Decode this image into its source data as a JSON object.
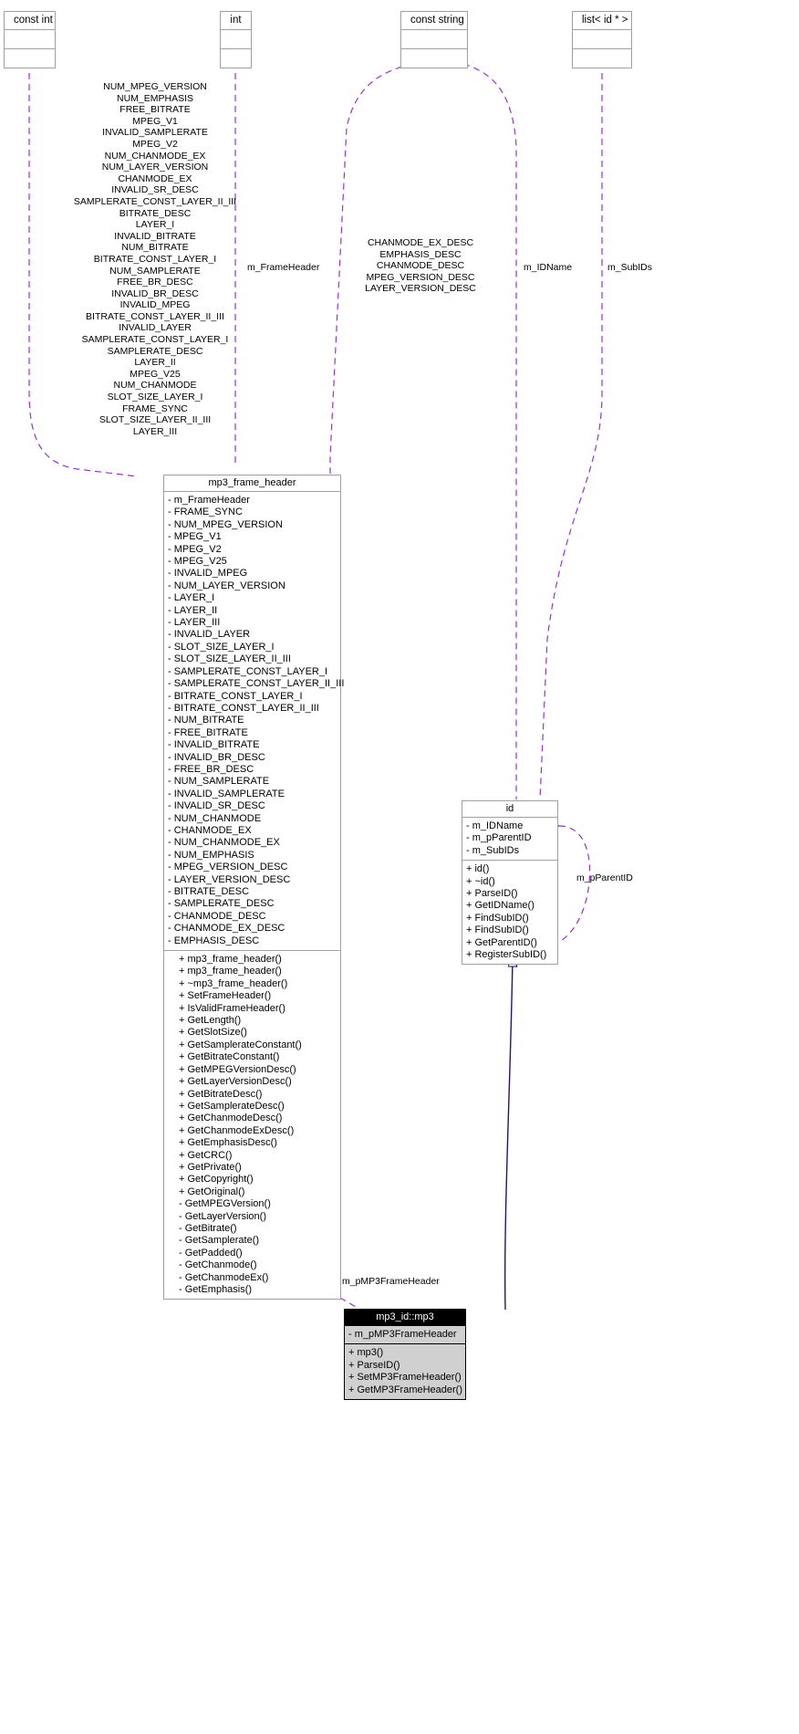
{
  "diagram": {
    "kind": "uml-collaboration-diagram",
    "colors": {
      "usage_edge": "#9a32cd",
      "inheritance_edge": "#191970",
      "box_border": "#a0a0a0",
      "current_header_bg": "#000000",
      "current_header_fg": "#ffffff",
      "current_body_bg": "#d0d0d0"
    }
  },
  "type_boxes": [
    {
      "name": "const int"
    },
    {
      "name": "int"
    },
    {
      "name": "const string"
    },
    {
      "name": "list< id * >"
    }
  ],
  "edge_labels": {
    "const_int_members": [
      "NUM_MPEG_VERSION",
      "NUM_EMPHASIS",
      "FREE_BITRATE",
      "MPEG_V1",
      "INVALID_SAMPLERATE",
      "MPEG_V2",
      "NUM_CHANMODE_EX",
      "NUM_LAYER_VERSION",
      "CHANMODE_EX",
      "INVALID_SR_DESC",
      "SAMPLERATE_CONST_LAYER_II_III",
      "BITRATE_DESC",
      "LAYER_I",
      "INVALID_BITRATE",
      "NUM_BITRATE",
      "BITRATE_CONST_LAYER_I",
      "NUM_SAMPLERATE",
      "FREE_BR_DESC",
      "INVALID_BR_DESC",
      "INVALID_MPEG",
      "BITRATE_CONST_LAYER_II_III",
      "INVALID_LAYER",
      "SAMPLERATE_CONST_LAYER_I",
      "SAMPLERATE_DESC",
      "LAYER_II",
      "MPEG_V25",
      "NUM_CHANMODE",
      "SLOT_SIZE_LAYER_I",
      "FRAME_SYNC",
      "SLOT_SIZE_LAYER_II_III",
      "LAYER_III"
    ],
    "int_member": "m_FrameHeader",
    "const_string_members": [
      "CHANMODE_EX_DESC",
      "EMPHASIS_DESC",
      "CHANMODE_DESC",
      "MPEG_VERSION_DESC",
      "LAYER_VERSION_DESC"
    ],
    "id_name_member": "m_IDName",
    "sub_ids_member": "m_SubIDs",
    "parent_id_member": "m_pParentID",
    "mp3_frame_header_member": "m_pMP3FrameHeader"
  },
  "classes": {
    "mp3_frame_header": {
      "name": "mp3_frame_header",
      "attributes": [
        {
          "vis": "-",
          "label": "m_FrameHeader"
        },
        {
          "vis": "-",
          "label": "FRAME_SYNC"
        },
        {
          "vis": "-",
          "label": "NUM_MPEG_VERSION"
        },
        {
          "vis": "-",
          "label": "MPEG_V1"
        },
        {
          "vis": "-",
          "label": "MPEG_V2"
        },
        {
          "vis": "-",
          "label": "MPEG_V25"
        },
        {
          "vis": "-",
          "label": "INVALID_MPEG"
        },
        {
          "vis": "-",
          "label": "NUM_LAYER_VERSION"
        },
        {
          "vis": "-",
          "label": "LAYER_I"
        },
        {
          "vis": "-",
          "label": "LAYER_II"
        },
        {
          "vis": "-",
          "label": "LAYER_III"
        },
        {
          "vis": "-",
          "label": "INVALID_LAYER"
        },
        {
          "vis": "-",
          "label": "SLOT_SIZE_LAYER_I"
        },
        {
          "vis": "-",
          "label": "SLOT_SIZE_LAYER_II_III"
        },
        {
          "vis": "-",
          "label": "SAMPLERATE_CONST_LAYER_I"
        },
        {
          "vis": "-",
          "label": "SAMPLERATE_CONST_LAYER_II_III"
        },
        {
          "vis": "-",
          "label": "BITRATE_CONST_LAYER_I"
        },
        {
          "vis": "-",
          "label": "BITRATE_CONST_LAYER_II_III"
        },
        {
          "vis": "-",
          "label": "NUM_BITRATE"
        },
        {
          "vis": "-",
          "label": "FREE_BITRATE"
        },
        {
          "vis": "-",
          "label": "INVALID_BITRATE"
        },
        {
          "vis": "-",
          "label": "INVALID_BR_DESC"
        },
        {
          "vis": "-",
          "label": "FREE_BR_DESC"
        },
        {
          "vis": "-",
          "label": "NUM_SAMPLERATE"
        },
        {
          "vis": "-",
          "label": "INVALID_SAMPLERATE"
        },
        {
          "vis": "-",
          "label": "INVALID_SR_DESC"
        },
        {
          "vis": "-",
          "label": "NUM_CHANMODE"
        },
        {
          "vis": "-",
          "label": "CHANMODE_EX"
        },
        {
          "vis": "-",
          "label": "NUM_CHANMODE_EX"
        },
        {
          "vis": "-",
          "label": "NUM_EMPHASIS"
        },
        {
          "vis": "-",
          "label": "MPEG_VERSION_DESC"
        },
        {
          "vis": "-",
          "label": "LAYER_VERSION_DESC"
        },
        {
          "vis": "-",
          "label": "BITRATE_DESC"
        },
        {
          "vis": "-",
          "label": "SAMPLERATE_DESC"
        },
        {
          "vis": "-",
          "label": "CHANMODE_DESC"
        },
        {
          "vis": "-",
          "label": "CHANMODE_EX_DESC"
        },
        {
          "vis": "-",
          "label": "EMPHASIS_DESC"
        }
      ],
      "methods": [
        {
          "vis": "+",
          "label": "mp3_frame_header()"
        },
        {
          "vis": "+",
          "label": "mp3_frame_header()"
        },
        {
          "vis": "+",
          "label": "~mp3_frame_header()"
        },
        {
          "vis": "+",
          "label": "SetFrameHeader()"
        },
        {
          "vis": "+",
          "label": "IsValidFrameHeader()"
        },
        {
          "vis": "+",
          "label": "GetLength()"
        },
        {
          "vis": "+",
          "label": "GetSlotSize()"
        },
        {
          "vis": "+",
          "label": "GetSamplerateConstant()"
        },
        {
          "vis": "+",
          "label": "GetBitrateConstant()"
        },
        {
          "vis": "+",
          "label": "GetMPEGVersionDesc()"
        },
        {
          "vis": "+",
          "label": "GetLayerVersionDesc()"
        },
        {
          "vis": "+",
          "label": "GetBitrateDesc()"
        },
        {
          "vis": "+",
          "label": "GetSamplerateDesc()"
        },
        {
          "vis": "+",
          "label": "GetChanmodeDesc()"
        },
        {
          "vis": "+",
          "label": "GetChanmodeExDesc()"
        },
        {
          "vis": "+",
          "label": "GetEmphasisDesc()"
        },
        {
          "vis": "+",
          "label": "GetCRC()"
        },
        {
          "vis": "+",
          "label": "GetPrivate()"
        },
        {
          "vis": "+",
          "label": "GetCopyright()"
        },
        {
          "vis": "+",
          "label": "GetOriginal()"
        },
        {
          "vis": "-",
          "label": "GetMPEGVersion()"
        },
        {
          "vis": "-",
          "label": "GetLayerVersion()"
        },
        {
          "vis": "-",
          "label": "GetBitrate()"
        },
        {
          "vis": "-",
          "label": "GetSamplerate()"
        },
        {
          "vis": "-",
          "label": "GetPadded()"
        },
        {
          "vis": "-",
          "label": "GetChanmode()"
        },
        {
          "vis": "-",
          "label": "GetChanmodeEx()"
        },
        {
          "vis": "-",
          "label": "GetEmphasis()"
        }
      ]
    },
    "id": {
      "name": "id",
      "attributes": [
        {
          "vis": "-",
          "label": "m_IDName"
        },
        {
          "vis": "-",
          "label": "m_pParentID"
        },
        {
          "vis": "-",
          "label": "m_SubIDs"
        }
      ],
      "methods": [
        {
          "vis": "+",
          "label": "id()"
        },
        {
          "vis": "+",
          "label": "~id()"
        },
        {
          "vis": "+",
          "label": "ParseID()"
        },
        {
          "vis": "+",
          "label": "GetIDName()"
        },
        {
          "vis": "+",
          "label": "FindSubID()"
        },
        {
          "vis": "+",
          "label": "FindSubID()"
        },
        {
          "vis": "+",
          "label": "GetParentID()"
        },
        {
          "vis": "+",
          "label": "RegisterSubID()"
        }
      ]
    },
    "mp3_id_mp3": {
      "name": "mp3_id::mp3",
      "attributes": [
        {
          "vis": "-",
          "label": "m_pMP3FrameHeader"
        }
      ],
      "methods": [
        {
          "vis": "+",
          "label": "mp3()"
        },
        {
          "vis": "+",
          "label": "ParseID()"
        },
        {
          "vis": "+",
          "label": "SetMP3FrameHeader()"
        },
        {
          "vis": "+",
          "label": "GetMP3FrameHeader()"
        }
      ]
    }
  }
}
